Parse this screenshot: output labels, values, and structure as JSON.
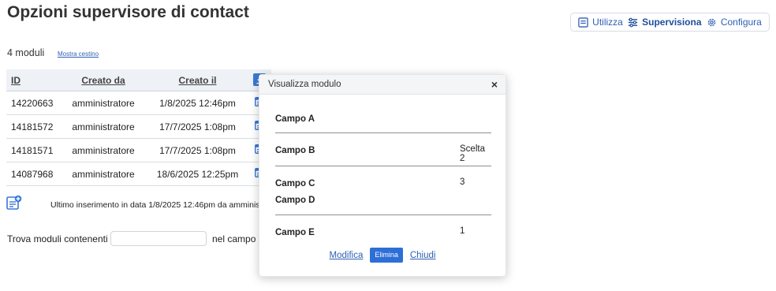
{
  "page": {
    "title": "Opzioni supervisore di contact"
  },
  "modes": [
    {
      "label": "Utilizza",
      "icon": "form-icon",
      "active": false
    },
    {
      "label": "Supervisiona",
      "icon": "sliders-icon",
      "active": true
    },
    {
      "label": "Configura",
      "icon": "gear-icon",
      "active": false
    }
  ],
  "summary": {
    "count_text": "4 moduli",
    "trash_link": "Mostra cestino"
  },
  "table": {
    "headers": {
      "id": "ID",
      "created_by": "Creato da",
      "created_at": "Creato il"
    },
    "rows": [
      {
        "id": "14220663",
        "by": "amministratore",
        "at": "1/8/2025 12:46pm"
      },
      {
        "id": "14181572",
        "by": "amministratore",
        "at": "17/7/2025 1:08pm"
      },
      {
        "id": "14181571",
        "by": "amministratore",
        "at": "17/7/2025 1:08pm"
      },
      {
        "id": "14087968",
        "by": "amministratore",
        "at": "18/6/2025 12:25pm"
      }
    ]
  },
  "last_insert": "Ultimo inserimento in data 1/8/2025 12:46pm da amminis",
  "search": {
    "label": "Trova moduli contenenti",
    "value": "",
    "field_label": "nel campo"
  },
  "modal": {
    "title": "Visualizza modulo",
    "close": "×",
    "fields": [
      {
        "name": "Campo A",
        "value": ""
      },
      {
        "name": "Campo B",
        "value": "Scelta 2"
      },
      {
        "name": "Campo C",
        "value": "3"
      },
      {
        "name": "Campo D",
        "value": ""
      },
      {
        "name": "Campo E",
        "value": "1"
      }
    ],
    "actions": {
      "edit": "Modifica",
      "delete": "Elimina",
      "close": "Chiudi"
    }
  },
  "colors": {
    "accent": "#2f5fb3",
    "button": "#2d6fd6",
    "header_bg": "#eef1f5"
  }
}
